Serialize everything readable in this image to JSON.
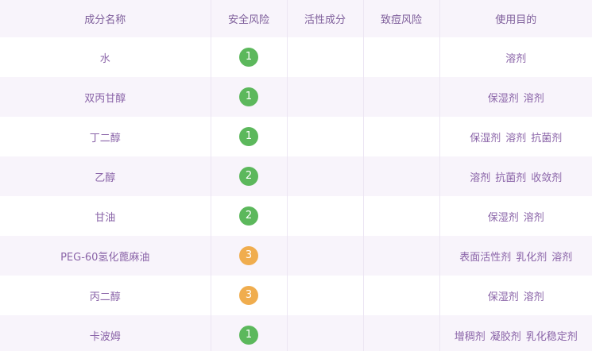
{
  "colors": {
    "text": "#8a64a8",
    "header_bg": "#f8f4fb",
    "risk_low": "#5cb85c",
    "risk_mid": "#f0ad4e"
  },
  "headers": [
    "成分名称",
    "安全风险",
    "活性成分",
    "致痘风险",
    "使用目的"
  ],
  "rows": [
    {
      "name": "水",
      "risk": "1",
      "risk_level": "low",
      "active": "",
      "acne": "",
      "purposes": [
        "溶剂"
      ]
    },
    {
      "name": "双丙甘醇",
      "risk": "1",
      "risk_level": "low",
      "active": "",
      "acne": "",
      "purposes": [
        "保湿剂",
        "溶剂"
      ]
    },
    {
      "name": "丁二醇",
      "risk": "1",
      "risk_level": "low",
      "active": "",
      "acne": "",
      "purposes": [
        "保湿剂",
        "溶剂",
        "抗菌剂"
      ]
    },
    {
      "name": "乙醇",
      "risk": "2",
      "risk_level": "low",
      "active": "",
      "acne": "",
      "purposes": [
        "溶剂",
        "抗菌剂",
        "收敛剂"
      ]
    },
    {
      "name": "甘油",
      "risk": "2",
      "risk_level": "low",
      "active": "",
      "acne": "",
      "purposes": [
        "保湿剂",
        "溶剂"
      ]
    },
    {
      "name": "PEG-60氢化蓖麻油",
      "risk": "3",
      "risk_level": "mid",
      "active": "",
      "acne": "",
      "purposes": [
        "表面活性剂",
        "乳化剂",
        "溶剂"
      ]
    },
    {
      "name": "丙二醇",
      "risk": "3",
      "risk_level": "mid",
      "active": "",
      "acne": "",
      "purposes": [
        "保湿剂",
        "溶剂"
      ]
    },
    {
      "name": "卡波姆",
      "risk": "1",
      "risk_level": "low",
      "active": "",
      "acne": "",
      "purposes": [
        "增稠剂",
        "凝胶剂",
        "乳化稳定剂"
      ]
    }
  ]
}
